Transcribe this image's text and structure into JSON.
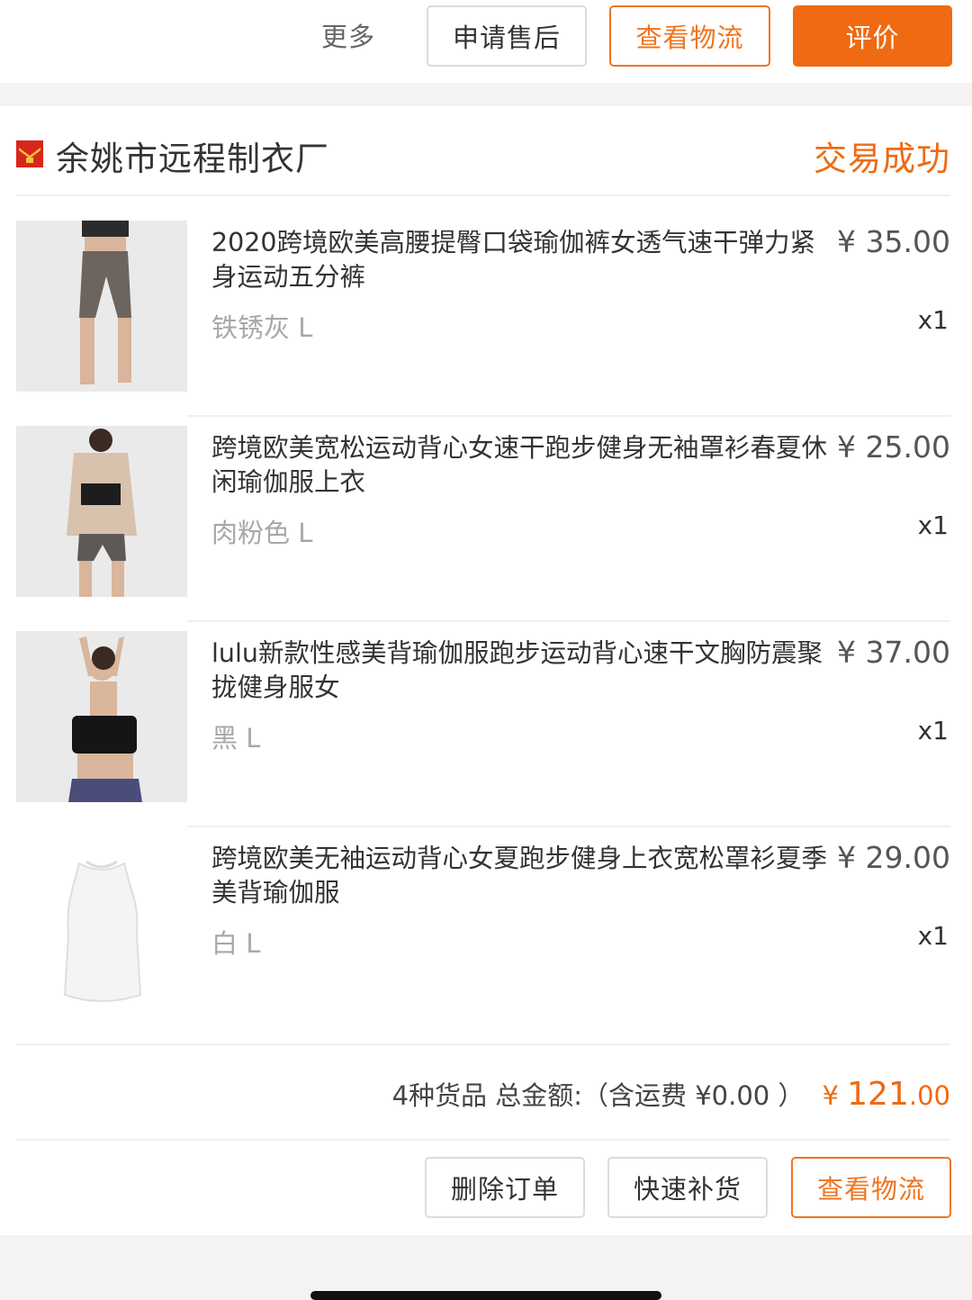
{
  "top_actions": {
    "more": "更多",
    "after_sale": "申请售后",
    "logistics": "查看物流",
    "review": "评价"
  },
  "shop": {
    "name": "余姚市远程制衣厂",
    "status": "交易成功",
    "icon": "shop-badge-icon"
  },
  "items": [
    {
      "title": "2020跨境欧美高腰提臀口袋瑜伽裤女透气速干弹力紧身运动五分裤",
      "price": "¥ 35.00",
      "spec": "铁锈灰 L",
      "qty": "x1",
      "image": "gray-biker-shorts"
    },
    {
      "title": "跨境欧美宽松运动背心女速干跑步健身无袖罩衫春夏休闲瑜伽服上衣",
      "price": "¥ 25.00",
      "spec": "肉粉色 L",
      "qty": "x1",
      "image": "beige-open-back-tank"
    },
    {
      "title": "lulu新款性感美背瑜伽服跑步运动背心速干文胸防震聚拢健身服女",
      "price": "¥ 37.00",
      "spec": "黑 L",
      "qty": "x1",
      "image": "black-sports-bra"
    },
    {
      "title": "跨境欧美无袖运动背心女夏跑步健身上衣宽松罩衫夏季美背瑜伽服",
      "price": "¥ 29.00",
      "spec": "白 L",
      "qty": "x1",
      "image": "white-tank-top"
    }
  ],
  "summary": {
    "text": "4种货品 总金额:（含运费 ¥0.00 ）",
    "currency": "¥",
    "amount_int": "121",
    "amount_dec": ".00"
  },
  "bottom_actions": {
    "delete": "删除订单",
    "reorder": "快速补货",
    "logistics": "查看物流"
  },
  "colors": {
    "accent": "#ef6a12",
    "text": "#333333",
    "muted": "#a8a8a8",
    "background": "#f3f3f3"
  }
}
